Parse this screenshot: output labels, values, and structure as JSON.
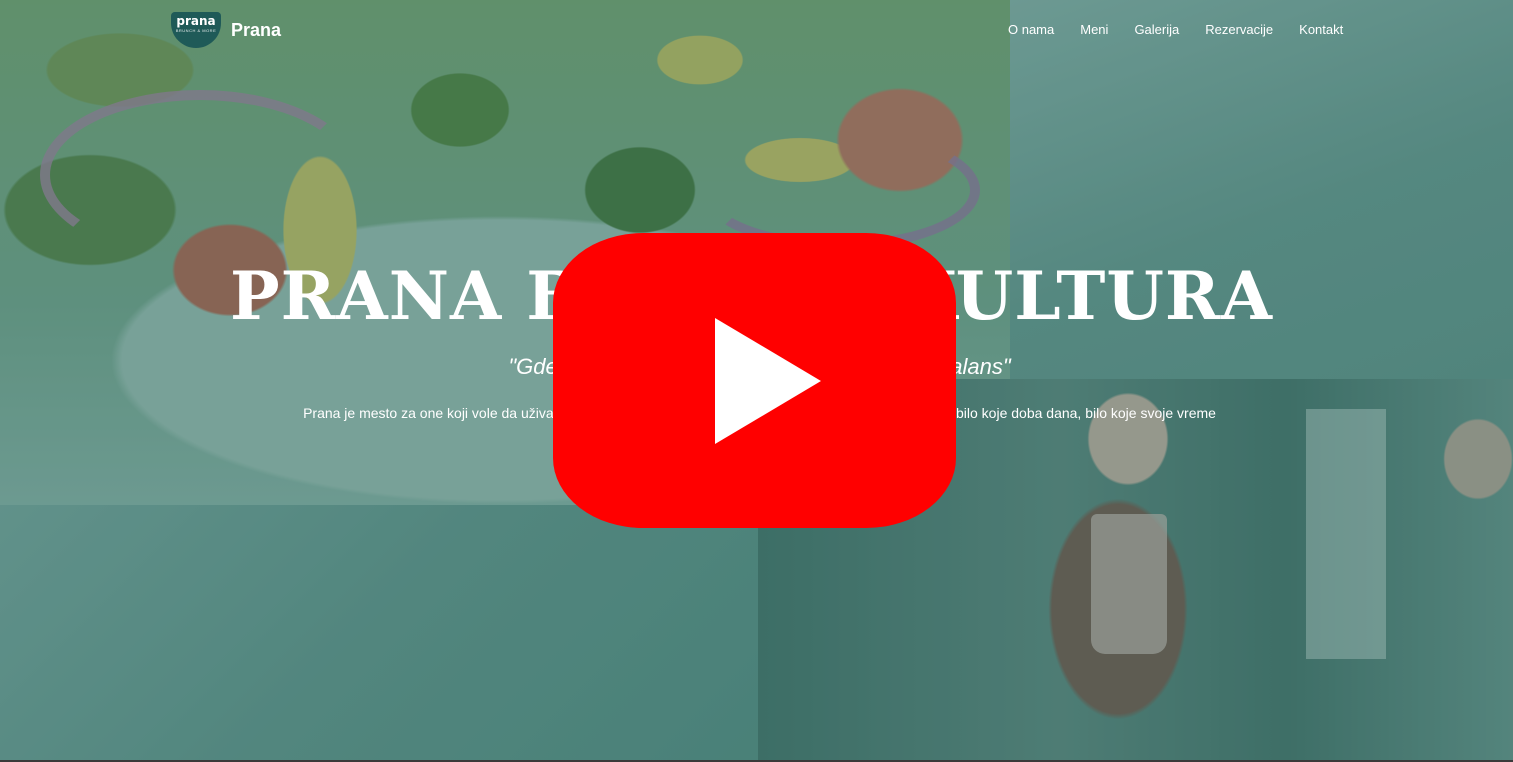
{
  "header": {
    "logo_text": "prana",
    "logo_subtext": "BRUNCH & MORE",
    "brand_name": "Prana",
    "nav": [
      {
        "label": "O nama"
      },
      {
        "label": "Meni"
      },
      {
        "label": "Galerija"
      },
      {
        "label": "Rezervacije"
      },
      {
        "label": "Kontakt"
      }
    ]
  },
  "hero": {
    "title": "PRANA BRUNCH KULTURA",
    "tagline": "\"Gde hrana, ukus i zdravlje pronalaze svoju balans\"",
    "description": "Prana je mesto za one koji vole da uživaju u dobroj hrani i kvalitetno provedenom slobodnom vremenu, u bilo koje doba dana, bilo koje svoje vreme"
  },
  "video": {
    "play_icon": "youtube-play-icon",
    "accent": "#ff0000"
  },
  "colors": {
    "overlay": "#5f9088",
    "text": "#ffffff"
  }
}
